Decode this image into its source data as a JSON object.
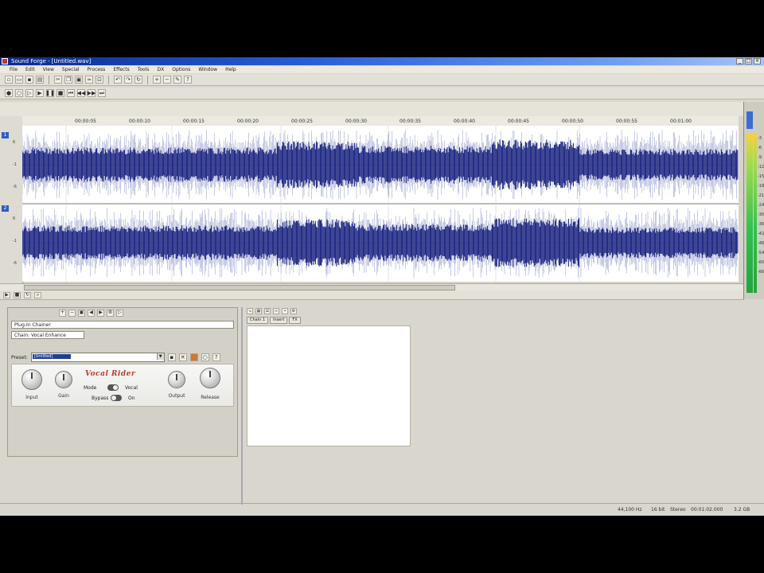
{
  "app": {
    "title": "Sound Forge - [Untitled.wav]"
  },
  "menus": [
    "File",
    "Edit",
    "View",
    "Special",
    "Process",
    "Effects",
    "Tools",
    "DX",
    "Options",
    "Window",
    "Help"
  ],
  "ruler": {
    "ticks": [
      "00:00:05",
      "00:00:10",
      "00:00:15",
      "00:00:20",
      "00:00:25",
      "00:00:30",
      "00:00:35",
      "00:00:40",
      "00:00:45",
      "00:00:50",
      "00:00:55",
      "00:01:00"
    ]
  },
  "channels": [
    {
      "label": "1",
      "scale": [
        "6",
        "-1",
        "-6"
      ]
    },
    {
      "label": "2",
      "scale": [
        "6",
        "-1",
        "-6"
      ]
    }
  ],
  "meter": {
    "ticks": [
      "-3",
      "-6",
      "-9",
      "-12",
      "-15",
      "-18",
      "-21",
      "-24",
      "-30",
      "-36",
      "-42",
      "-48",
      "-54",
      "-60",
      "-66"
    ]
  },
  "fx": {
    "list_title": "Plug-In Chainer",
    "tab_label": "Chain: Vocal Enhance",
    "preset_label": "Preset:",
    "preset_value": "[Untitled]",
    "plugin_name": "Vocal Rider",
    "knobs": [
      "Input",
      "Gain",
      "Output",
      "Release"
    ],
    "switch_labels": [
      "Mode",
      "Vocal",
      "Bypass",
      "On"
    ]
  },
  "chain": {
    "tabs": [
      "Chain 1",
      "Insert",
      "FX"
    ]
  },
  "status": {
    "items": [
      "44,100 Hz",
      "16 bit",
      "Stereo",
      "00:01:02.000",
      "3.2 GB"
    ]
  }
}
